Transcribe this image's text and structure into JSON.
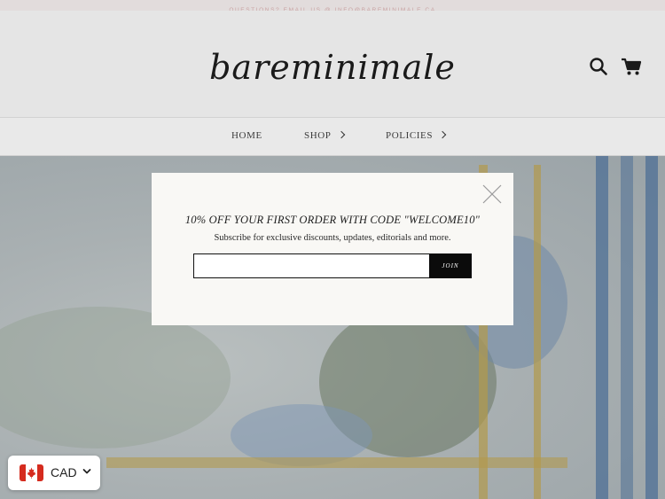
{
  "announcement": {
    "text": "QUESTIONS? EMAIL US @ INFO@BAREMINIMALE.CA"
  },
  "header": {
    "logo": "bareminimale",
    "icons": {
      "search": "search-icon",
      "cart": "cart-icon"
    }
  },
  "nav": {
    "items": [
      {
        "label": "HOME",
        "has_submenu": false
      },
      {
        "label": "SHOP",
        "has_submenu": true
      },
      {
        "label": "POLICIES",
        "has_submenu": true
      }
    ]
  },
  "popup": {
    "title": "10% OFF YOUR FIRST ORDER WITH CODE \"WELCOME10\"",
    "subtitle": "Subscribe for exclusive discounts, updates, editorials and more.",
    "email_value": "",
    "email_placeholder": "",
    "join_label": "JOIN",
    "close_icon": "close-icon"
  },
  "currency": {
    "code": "CAD",
    "flag": "canada-flag-icon"
  },
  "colors": {
    "announcement_text": "#c9a4a4",
    "button_bg": "#0b0b0b",
    "modal_bg": "#f9f8f5",
    "flag_red": "#d52b1e"
  }
}
